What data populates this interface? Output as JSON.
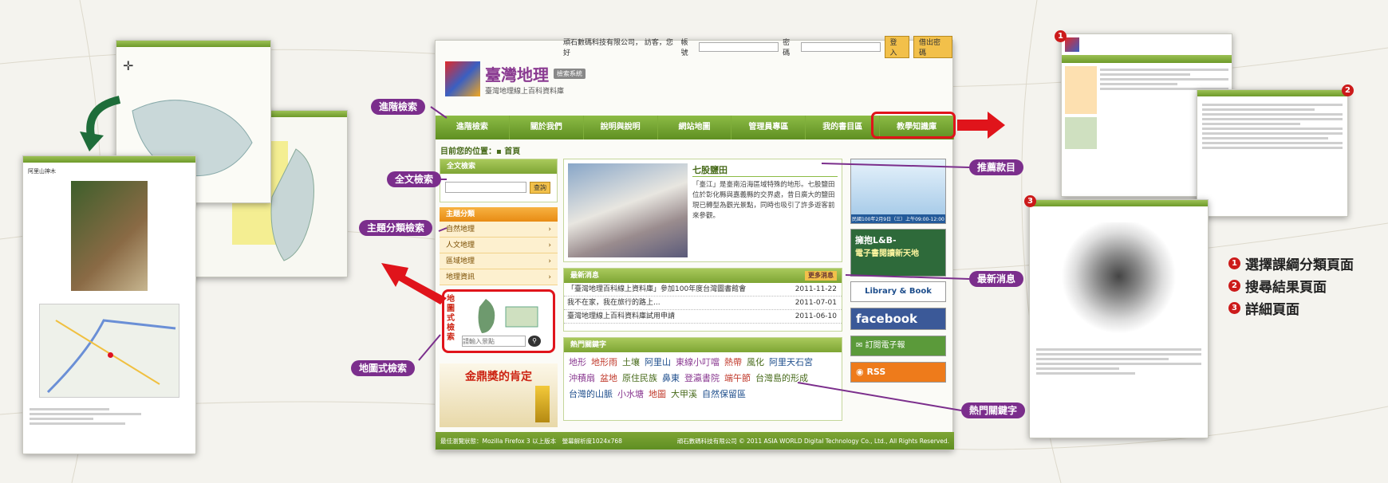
{
  "header": {
    "user_greeting": "頑石數碼科技有限公司，  訪客，您好",
    "account_label": "帳號",
    "password_label": "密碼",
    "login_btn": "登入",
    "logout_btn": "借出密碼",
    "logo_title": "臺灣地理",
    "logo_badge": "檢索系統",
    "logo_subtitle": "臺灣地理線上百科資料庫"
  },
  "nav": [
    "進階檢索",
    "關於我們",
    "說明與說明",
    "網站地圖",
    "管理員專區",
    "我的書目區",
    "教學知識庫"
  ],
  "breadcrumb": {
    "label": "目前您的位置：",
    "home": "首頁"
  },
  "search": {
    "title": "全文檢索",
    "button": "查詢"
  },
  "categories": {
    "title": "主題分類",
    "items": [
      "自然地理",
      "人文地理",
      "區域地理",
      "地理資訊"
    ]
  },
  "map_search": {
    "title": "地圖式檢索",
    "placeholder": "請輸入景點"
  },
  "award": {
    "title": "金鼎獎的肯定"
  },
  "feature": {
    "title": "七股鹽田",
    "text": "「臺江」是臺南沿海區域特殊的地形。七股鹽田位於彰化縣與嘉義縣的交界處，昔日廣大的鹽田現已轉型為觀光景點，同時也吸引了許多遊客前來參觀。"
  },
  "news": {
    "title": "最新消息",
    "more": "更多消息",
    "items": [
      {
        "text": "「臺灣地理百科線上資料庫」參加100年度台灣圖書館會",
        "date": "2011-11-22"
      },
      {
        "text": "我不在家，我在旅行的路上...",
        "date": "2011-07-01"
      },
      {
        "text": "臺灣地理線上百科資料庫試用申請",
        "date": "2011-06-10"
      }
    ]
  },
  "keywords": {
    "title": "熱門關鍵字",
    "items": [
      "地形",
      "地形雨",
      "土壤",
      "阿里山",
      "東線小叮噹",
      "熱帶",
      "風化",
      "阿里天石宮",
      "沖積扇",
      "盆地",
      "原住民族",
      "鼻東",
      "登瀛書院",
      "端午節",
      "台灣島的形成",
      "台灣的山脈",
      "小水塘",
      "地圖",
      "大甲溪",
      "自然保留區"
    ]
  },
  "right_banners": {
    "event_caption": "民國100年2月9日（三）上午09:00-12:00",
    "lb_title": "擁抱L&B-",
    "lb_sub": "電子書閱讀新天地",
    "lb_book": "Library & Book",
    "facebook": "facebook",
    "epaper": "訂閱電子報",
    "rss": "RSS"
  },
  "footer": {
    "left": "最佳瀏覽狀態：Mozilla Firefox 3 以上版本　螢幕解析度1024x768",
    "right": "頑石數碼科技有限公司 © 2011 ASIA WORLD Digital Technology Co., Ltd., All Rights Reserved."
  },
  "callouts": {
    "advanced": "進階檢索",
    "fulltext": "全文檢索",
    "category": "主題分類檢索",
    "map": "地圖式檢索",
    "recommend": "推薦款目",
    "news": "最新消息",
    "keywords": "熱門關鍵字"
  },
  "legend": {
    "items": [
      {
        "num": "1",
        "text": "選擇課綱分類頁面"
      },
      {
        "num": "2",
        "text": "搜尋結果頁面"
      },
      {
        "num": "3",
        "text": "詳細頁面"
      }
    ]
  },
  "left_panel": {
    "title": "阿里山神木"
  },
  "colors": {
    "accent_green": "#6e9a2a",
    "callout_purple": "#7b2e8c",
    "highlight_red": "#e0141b"
  }
}
